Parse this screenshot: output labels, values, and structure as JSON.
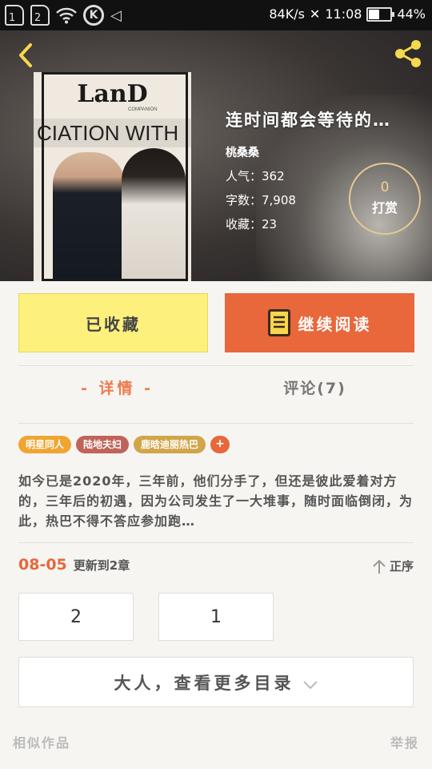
{
  "status_bar": {
    "sim1": "1",
    "sim2": "2",
    "k_icon": "K",
    "net_speed": "84K/s",
    "time": "11:08",
    "battery_percent": "44%",
    "battery_level": 0.44
  },
  "book": {
    "cover_magazine": "LanD",
    "cover_magazine_sub": "COMPANION",
    "cover_band_text": "CIATION WITH",
    "title": "连时间都会等待的…",
    "author": "桃桑桑",
    "popularity": "人气：362",
    "word_count": "字数：7,908",
    "favorites": "收藏：23",
    "tip_count": "0",
    "tip_label": "打赏"
  },
  "actions": {
    "fav_label": "已收藏",
    "read_label": "继续阅读"
  },
  "tabs": {
    "detail": "- 详情 -",
    "comments": "评论(7)"
  },
  "tags": [
    {
      "label": "明星同人",
      "color": "#f0a531"
    },
    {
      "label": "陆地夫妇",
      "color": "#c0645a"
    },
    {
      "label": "鹿晗迪丽热巴",
      "color": "#d1a54a"
    }
  ],
  "tag_add": "+",
  "description": "如今已是2020年，三年前，他们分手了，但还是彼此爱着对方的，三年后的初遇，因为公司发生了一大堆事，随时面临倒闭，为此，热巴不得不答应参加跑…",
  "update": {
    "date": "08-05",
    "text": "更新到2章",
    "sort_label": "正序"
  },
  "chapters": [
    "2",
    "1"
  ],
  "more_toc_label": "大人，查看更多目录",
  "footer": {
    "similar": "相似作品",
    "report": "举报"
  },
  "colors": {
    "accent": "#e8673b",
    "fav_yellow": "#fdf07d",
    "tip_gold": "#e5c891"
  },
  "icons": [
    "back-arrow-icon",
    "share-icon",
    "book-icon",
    "sort-up-arrow-icon",
    "chevron-down-icon",
    "wifi-icon",
    "mute-speaker-icon",
    "battery-icon"
  ]
}
